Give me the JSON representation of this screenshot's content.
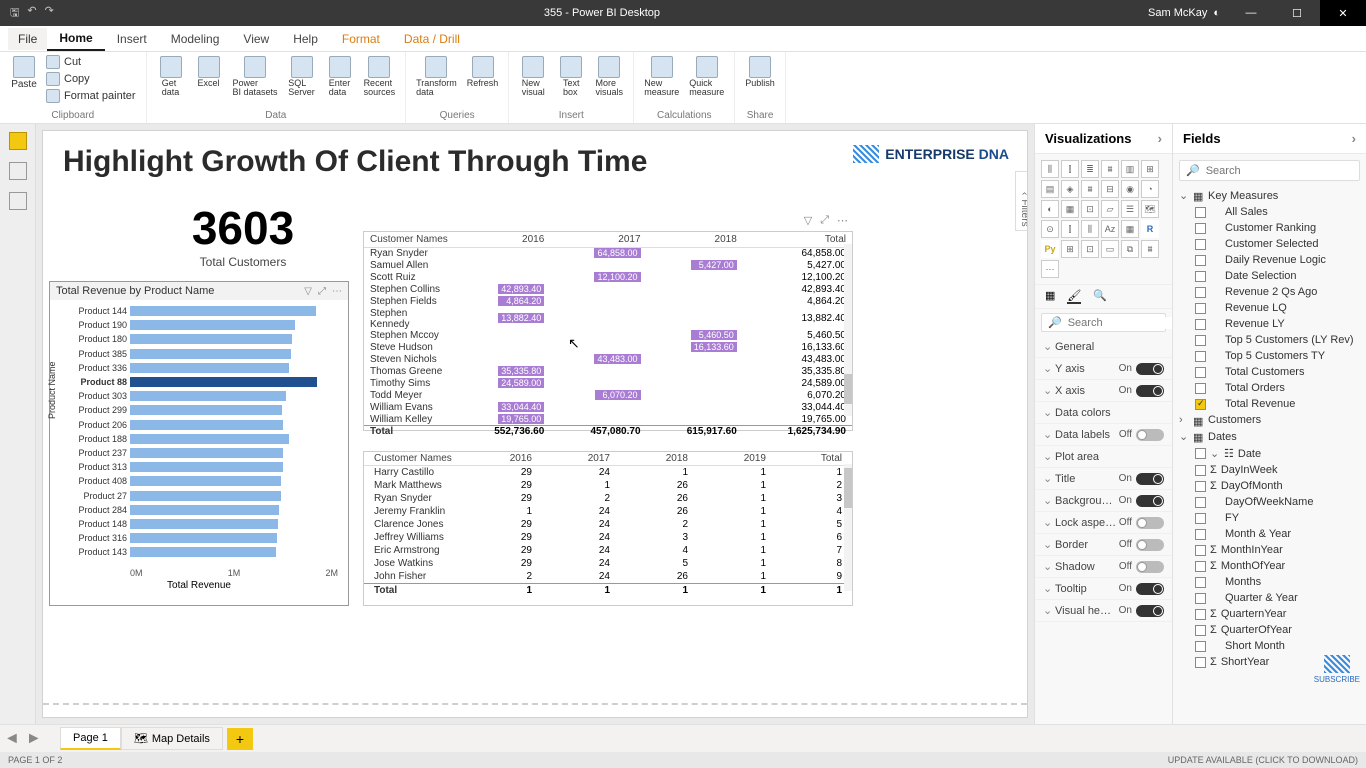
{
  "titlebar": {
    "title": "355 - Power BI Desktop",
    "user": "Sam McKay"
  },
  "tabs": {
    "file": "File",
    "list": [
      "Home",
      "Insert",
      "Modeling",
      "View",
      "Help",
      "Format",
      "Data / Drill"
    ],
    "active": "Home",
    "ctx_start": 5
  },
  "ribbon": {
    "clipboard": {
      "label": "Clipboard",
      "paste": "Paste",
      "cut": "Cut",
      "copy": "Copy",
      "fp": "Format painter"
    },
    "data": {
      "label": "Data",
      "btns": [
        "Get data",
        "Excel",
        "Power BI datasets",
        "SQL Server",
        "Enter data",
        "Recent sources"
      ]
    },
    "queries": {
      "label": "Queries",
      "btns": [
        "Transform data",
        "Refresh"
      ]
    },
    "insert": {
      "label": "Insert",
      "btns": [
        "New visual",
        "Text box",
        "More visuals"
      ]
    },
    "calc": {
      "label": "Calculations",
      "btns": [
        "New measure",
        "Quick measure"
      ]
    },
    "share": {
      "label": "Share",
      "btns": [
        "Publish"
      ]
    }
  },
  "report": {
    "title": "Highlight Growth Of Client Through Time",
    "brand": "ENTERPRISE",
    "brand2": "DNA",
    "metric": {
      "value": "3603",
      "label": "Total Customers"
    }
  },
  "chart_data": {
    "type": "bar",
    "title": "Total Revenue by Product Name",
    "xlabel": "Total Revenue",
    "ylabel": "Product Name",
    "xticks": [
      "0M",
      "1M",
      "2M"
    ],
    "xlim": [
      0,
      2000000
    ],
    "selected": "Product 88",
    "series": [
      {
        "name": "Product 144",
        "value": 1750000
      },
      {
        "name": "Product 190",
        "value": 1560000
      },
      {
        "name": "Product 180",
        "value": 1530000
      },
      {
        "name": "Product 385",
        "value": 1520000
      },
      {
        "name": "Product 336",
        "value": 1500000
      },
      {
        "name": "Product 88",
        "value": 1760000
      },
      {
        "name": "Product 303",
        "value": 1470000
      },
      {
        "name": "Product 299",
        "value": 1430000
      },
      {
        "name": "Product 206",
        "value": 1440000
      },
      {
        "name": "Product 188",
        "value": 1500000
      },
      {
        "name": "Product 237",
        "value": 1440000
      },
      {
        "name": "Product 313",
        "value": 1440000
      },
      {
        "name": "Product 408",
        "value": 1420000
      },
      {
        "name": "Product 27",
        "value": 1420000
      },
      {
        "name": "Product 284",
        "value": 1410000
      },
      {
        "name": "Product 148",
        "value": 1400000
      },
      {
        "name": "Product 316",
        "value": 1390000
      },
      {
        "name": "Product 143",
        "value": 1380000
      }
    ]
  },
  "matrix1": {
    "cols": [
      "Customer Names",
      "2016",
      "2017",
      "2018",
      "Total"
    ],
    "rows": [
      {
        "n": "Ryan Snyder",
        "c": [
          {
            "y": 2016,
            "v": ""
          },
          {
            "y": 2017,
            "v": "64,858.00",
            "h": 1
          },
          {
            "y": 2018,
            "v": ""
          }
        ],
        "t": "64,858.00"
      },
      {
        "n": "Samuel Allen",
        "c": [
          {
            "y": 2016,
            "v": ""
          },
          {
            "y": 2017,
            "v": ""
          },
          {
            "y": 2018,
            "v": "5,427.00",
            "h": 1
          }
        ],
        "t": "5,427.00"
      },
      {
        "n": "Scott Ruiz",
        "c": [
          {
            "y": 2016,
            "v": ""
          },
          {
            "y": 2017,
            "v": "12,100.20",
            "h": 1
          },
          {
            "y": 2018,
            "v": ""
          }
        ],
        "t": "12,100.20"
      },
      {
        "n": "Stephen Collins",
        "c": [
          {
            "y": 2016,
            "v": "42,893.40",
            "h": 1
          },
          {
            "y": 2017,
            "v": ""
          },
          {
            "y": 2018,
            "v": ""
          }
        ],
        "t": "42,893.40"
      },
      {
        "n": "Stephen Fields",
        "c": [
          {
            "y": 2016,
            "v": "4,864.20",
            "h": 1
          },
          {
            "y": 2017,
            "v": ""
          },
          {
            "y": 2018,
            "v": ""
          }
        ],
        "t": "4,864.20"
      },
      {
        "n": "Stephen Kennedy",
        "c": [
          {
            "y": 2016,
            "v": "13,882.40",
            "h": 1
          },
          {
            "y": 2017,
            "v": ""
          },
          {
            "y": 2018,
            "v": ""
          }
        ],
        "t": "13,882.40"
      },
      {
        "n": "Stephen Mccoy",
        "c": [
          {
            "y": 2016,
            "v": ""
          },
          {
            "y": 2017,
            "v": ""
          },
          {
            "y": 2018,
            "v": "5,460.50",
            "h": 1
          }
        ],
        "t": "5,460.50"
      },
      {
        "n": "Steve Hudson",
        "c": [
          {
            "y": 2016,
            "v": ""
          },
          {
            "y": 2017,
            "v": ""
          },
          {
            "y": 2018,
            "v": "16,133.60",
            "h": 1
          }
        ],
        "t": "16,133.60"
      },
      {
        "n": "Steven Nichols",
        "c": [
          {
            "y": 2016,
            "v": ""
          },
          {
            "y": 2017,
            "v": "43,483.00",
            "h": 1
          },
          {
            "y": 2018,
            "v": ""
          }
        ],
        "t": "43,483.00"
      },
      {
        "n": "Thomas Greene",
        "c": [
          {
            "y": 2016,
            "v": "35,335.80",
            "h": 1
          },
          {
            "y": 2017,
            "v": ""
          },
          {
            "y": 2018,
            "v": ""
          }
        ],
        "t": "35,335.80"
      },
      {
        "n": "Timothy Sims",
        "c": [
          {
            "y": 2016,
            "v": "24,589.00",
            "h": 1
          },
          {
            "y": 2017,
            "v": ""
          },
          {
            "y": 2018,
            "v": ""
          }
        ],
        "t": "24,589.00"
      },
      {
        "n": "Todd Meyer",
        "c": [
          {
            "y": 2016,
            "v": ""
          },
          {
            "y": 2017,
            "v": "6,070.20",
            "h": 1
          },
          {
            "y": 2018,
            "v": ""
          }
        ],
        "t": "6,070.20"
      },
      {
        "n": "William Evans",
        "c": [
          {
            "y": 2016,
            "v": "33,044.40",
            "h": 1
          },
          {
            "y": 2017,
            "v": ""
          },
          {
            "y": 2018,
            "v": ""
          }
        ],
        "t": "33,044.40"
      },
      {
        "n": "William Kelley",
        "c": [
          {
            "y": 2016,
            "v": "19,765.00",
            "h": 1
          },
          {
            "y": 2017,
            "v": ""
          },
          {
            "y": 2018,
            "v": ""
          }
        ],
        "t": "19,765.00"
      }
    ],
    "totals": [
      "Total",
      "552,736.60",
      "457,080.70",
      "615,917.60",
      "1,625,734.90"
    ]
  },
  "matrix2": {
    "cols": [
      "Customer Names",
      "2016",
      "2017",
      "2018",
      "2019",
      "Total"
    ],
    "rows": [
      [
        "Harry Castillo",
        "29",
        "24",
        "1",
        "1",
        "1"
      ],
      [
        "Mark Matthews",
        "29",
        "1",
        "26",
        "1",
        "2"
      ],
      [
        "Ryan Snyder",
        "29",
        "2",
        "26",
        "1",
        "3"
      ],
      [
        "Jeremy Franklin",
        "1",
        "24",
        "26",
        "1",
        "4"
      ],
      [
        "Clarence Jones",
        "29",
        "24",
        "2",
        "1",
        "5"
      ],
      [
        "Jeffrey Williams",
        "29",
        "24",
        "3",
        "1",
        "6"
      ],
      [
        "Eric Armstrong",
        "29",
        "24",
        "4",
        "1",
        "7"
      ],
      [
        "Jose Watkins",
        "29",
        "24",
        "5",
        "1",
        "8"
      ],
      [
        "John Fisher",
        "2",
        "24",
        "26",
        "1",
        "9"
      ]
    ],
    "totals": [
      "Total",
      "1",
      "1",
      "1",
      "1",
      "1"
    ]
  },
  "vispane": {
    "title": "Visualizations",
    "search": "Search",
    "props": [
      {
        "n": "General",
        "t": null
      },
      {
        "n": "Y axis",
        "t": "On"
      },
      {
        "n": "X axis",
        "t": "On"
      },
      {
        "n": "Data colors",
        "t": null
      },
      {
        "n": "Data labels",
        "t": "Off"
      },
      {
        "n": "Plot area",
        "t": null
      },
      {
        "n": "Title",
        "t": "On"
      },
      {
        "n": "Backgrou…",
        "t": "On"
      },
      {
        "n": "Lock aspe…",
        "t": "Off"
      },
      {
        "n": "Border",
        "t": "Off"
      },
      {
        "n": "Shadow",
        "t": "Off"
      },
      {
        "n": "Tooltip",
        "t": "On"
      },
      {
        "n": "Visual he…",
        "t": "On"
      }
    ]
  },
  "fieldspane": {
    "title": "Fields",
    "search": "Search",
    "groups": [
      {
        "name": "Key Measures",
        "type": "table",
        "expanded": true,
        "items": [
          {
            "n": "All Sales",
            "ck": 0
          },
          {
            "n": "Customer Ranking",
            "ck": 0
          },
          {
            "n": "Customer Selected",
            "ck": 0
          },
          {
            "n": "Daily Revenue Logic",
            "ck": 0
          },
          {
            "n": "Date Selection",
            "ck": 0
          },
          {
            "n": "Revenue 2 Qs Ago",
            "ck": 0
          },
          {
            "n": "Revenue LQ",
            "ck": 0
          },
          {
            "n": "Revenue LY",
            "ck": 0
          },
          {
            "n": "Top 5 Customers (LY Rev)",
            "ck": 0
          },
          {
            "n": "Top 5 Customers TY",
            "ck": 0
          },
          {
            "n": "Total Customers",
            "ck": 0
          },
          {
            "n": "Total Orders",
            "ck": 0
          },
          {
            "n": "Total Revenue",
            "ck": 1
          }
        ]
      },
      {
        "name": "Customers",
        "type": "table",
        "expanded": false,
        "items": []
      },
      {
        "name": "Dates",
        "type": "table",
        "expanded": true,
        "items": [
          {
            "n": "Date",
            "ck": 0,
            "hier": 1
          },
          {
            "n": "DayInWeek",
            "ck": 0,
            "sig": 1
          },
          {
            "n": "DayOfMonth",
            "ck": 0,
            "sig": 1
          },
          {
            "n": "DayOfWeekName",
            "ck": 0
          },
          {
            "n": "FY",
            "ck": 0
          },
          {
            "n": "Month & Year",
            "ck": 0
          },
          {
            "n": "MonthInYear",
            "ck": 0,
            "sig": 1
          },
          {
            "n": "MonthOfYear",
            "ck": 0,
            "sig": 1
          },
          {
            "n": "Months",
            "ck": 0
          },
          {
            "n": "Quarter & Year",
            "ck": 0
          },
          {
            "n": "QuarternYear",
            "ck": 0,
            "sig": 1
          },
          {
            "n": "QuarterOfYear",
            "ck": 0,
            "sig": 1
          },
          {
            "n": "Short Month",
            "ck": 0
          },
          {
            "n": "ShortYear",
            "ck": 0,
            "sig": 1
          }
        ]
      }
    ]
  },
  "pages": {
    "active": "Page 1",
    "other": "Map Details"
  },
  "status": {
    "left": "PAGE 1 OF 2",
    "right": "UPDATE AVAILABLE (CLICK TO DOWNLOAD)"
  },
  "filters_label": "Filters",
  "subscribe": "SUBSCRIBE"
}
